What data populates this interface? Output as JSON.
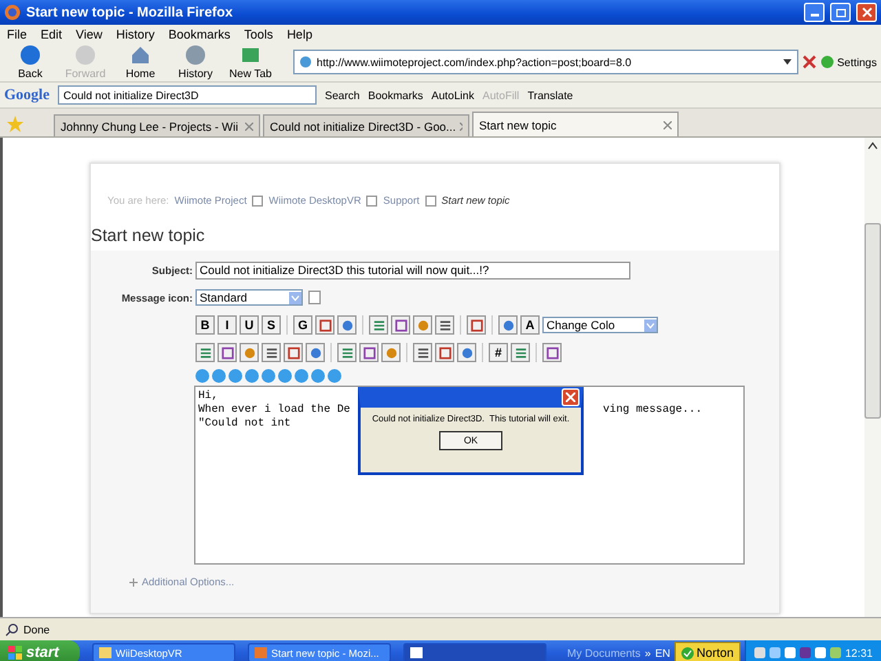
{
  "window": {
    "title": "Start new topic - Mozilla Firefox"
  },
  "menu": [
    "File",
    "Edit",
    "View",
    "History",
    "Bookmarks",
    "Tools",
    "Help"
  ],
  "nav_buttons": [
    {
      "label": "Back",
      "disabled": false
    },
    {
      "label": "Forward",
      "disabled": true
    },
    {
      "label": "Home",
      "disabled": false
    },
    {
      "label": "History",
      "disabled": false
    },
    {
      "label": "New Tab",
      "disabled": false
    }
  ],
  "address": {
    "url": "http://www.wiimoteproject.com/index.php?action=post;board=8.0"
  },
  "settings_label": "Settings",
  "google_toolbar": {
    "logo": "Google",
    "query": "Could not initialize Direct3D",
    "items": [
      {
        "label": "Search",
        "disabled": false
      },
      {
        "label": "Bookmarks",
        "disabled": false
      },
      {
        "label": "AutoLink",
        "disabled": false
      },
      {
        "label": "AutoFill",
        "disabled": true
      },
      {
        "label": "Translate",
        "disabled": false
      }
    ]
  },
  "tabs": [
    {
      "label": "Johnny Chung Lee - Projects - Wii",
      "selected": false
    },
    {
      "label": "Could not initialize Direct3D - Goo...",
      "selected": false
    },
    {
      "label": "Start new topic",
      "selected": true
    }
  ],
  "breadcrumb": {
    "prefix": "You are here:",
    "items": [
      {
        "label": "Wiimote Project",
        "current": false
      },
      {
        "label": "Wiimote DesktopVR",
        "current": false
      },
      {
        "label": "Support",
        "current": false
      },
      {
        "label": "Start new topic",
        "current": true
      }
    ]
  },
  "heading": "Start new topic",
  "form": {
    "subject_label": "Subject:",
    "subject_value": "Could not initialize Direct3D this tutorial will now quit...!?",
    "icon_label": "Message icon:",
    "icon_value": "Standard"
  },
  "toolbar_rows": [
    [
      {
        "kind": "letter",
        "label": "B"
      },
      {
        "kind": "letter",
        "label": "I"
      },
      {
        "kind": "letter",
        "label": "U"
      },
      {
        "kind": "letter",
        "label": "S"
      },
      {
        "kind": "separator"
      },
      {
        "kind": "letter",
        "label": "G"
      },
      {
        "kind": "icon"
      },
      {
        "kind": "icon"
      },
      {
        "kind": "separator"
      },
      {
        "kind": "icon"
      },
      {
        "kind": "icon"
      },
      {
        "kind": "icon"
      },
      {
        "kind": "icon"
      },
      {
        "kind": "separator"
      },
      {
        "kind": "icon"
      },
      {
        "kind": "separator"
      },
      {
        "kind": "icon"
      },
      {
        "kind": "letter",
        "label": "A"
      },
      {
        "kind": "select",
        "label": "Change Colo"
      }
    ],
    [
      {
        "kind": "icon"
      },
      {
        "kind": "icon"
      },
      {
        "kind": "icon"
      },
      {
        "kind": "icon"
      },
      {
        "kind": "icon"
      },
      {
        "kind": "icon"
      },
      {
        "kind": "separator"
      },
      {
        "kind": "icon"
      },
      {
        "kind": "icon"
      },
      {
        "kind": "icon"
      },
      {
        "kind": "separator"
      },
      {
        "kind": "icon"
      },
      {
        "kind": "icon"
      },
      {
        "kind": "icon"
      },
      {
        "kind": "separator"
      },
      {
        "kind": "letter",
        "label": "#"
      },
      {
        "kind": "icon"
      },
      {
        "kind": "separator"
      },
      {
        "kind": "icon"
      }
    ]
  ],
  "editor_lines": [
    {
      "left": "Hi,"
    },
    {
      "left": "When ever i load the De",
      "right": "ving message..."
    },
    {
      "left": "\"Could not int"
    }
  ],
  "additional_options": "Additional Options...",
  "dialog": {
    "message": "Could not initialize Direct3D.  This tutorial will exit.",
    "ok": "OK"
  },
  "status": "Done",
  "taskbar": {
    "start": "start",
    "buttons": [
      {
        "label": "WiiDesktopVR",
        "selected": false
      },
      {
        "label": "Start new topic - Mozi...",
        "selected": false
      },
      {
        "selected": true
      }
    ],
    "quick_launch": "My Documents",
    "chevron": "»",
    "language": "EN",
    "norton": "Norton",
    "clock": "12:31"
  }
}
